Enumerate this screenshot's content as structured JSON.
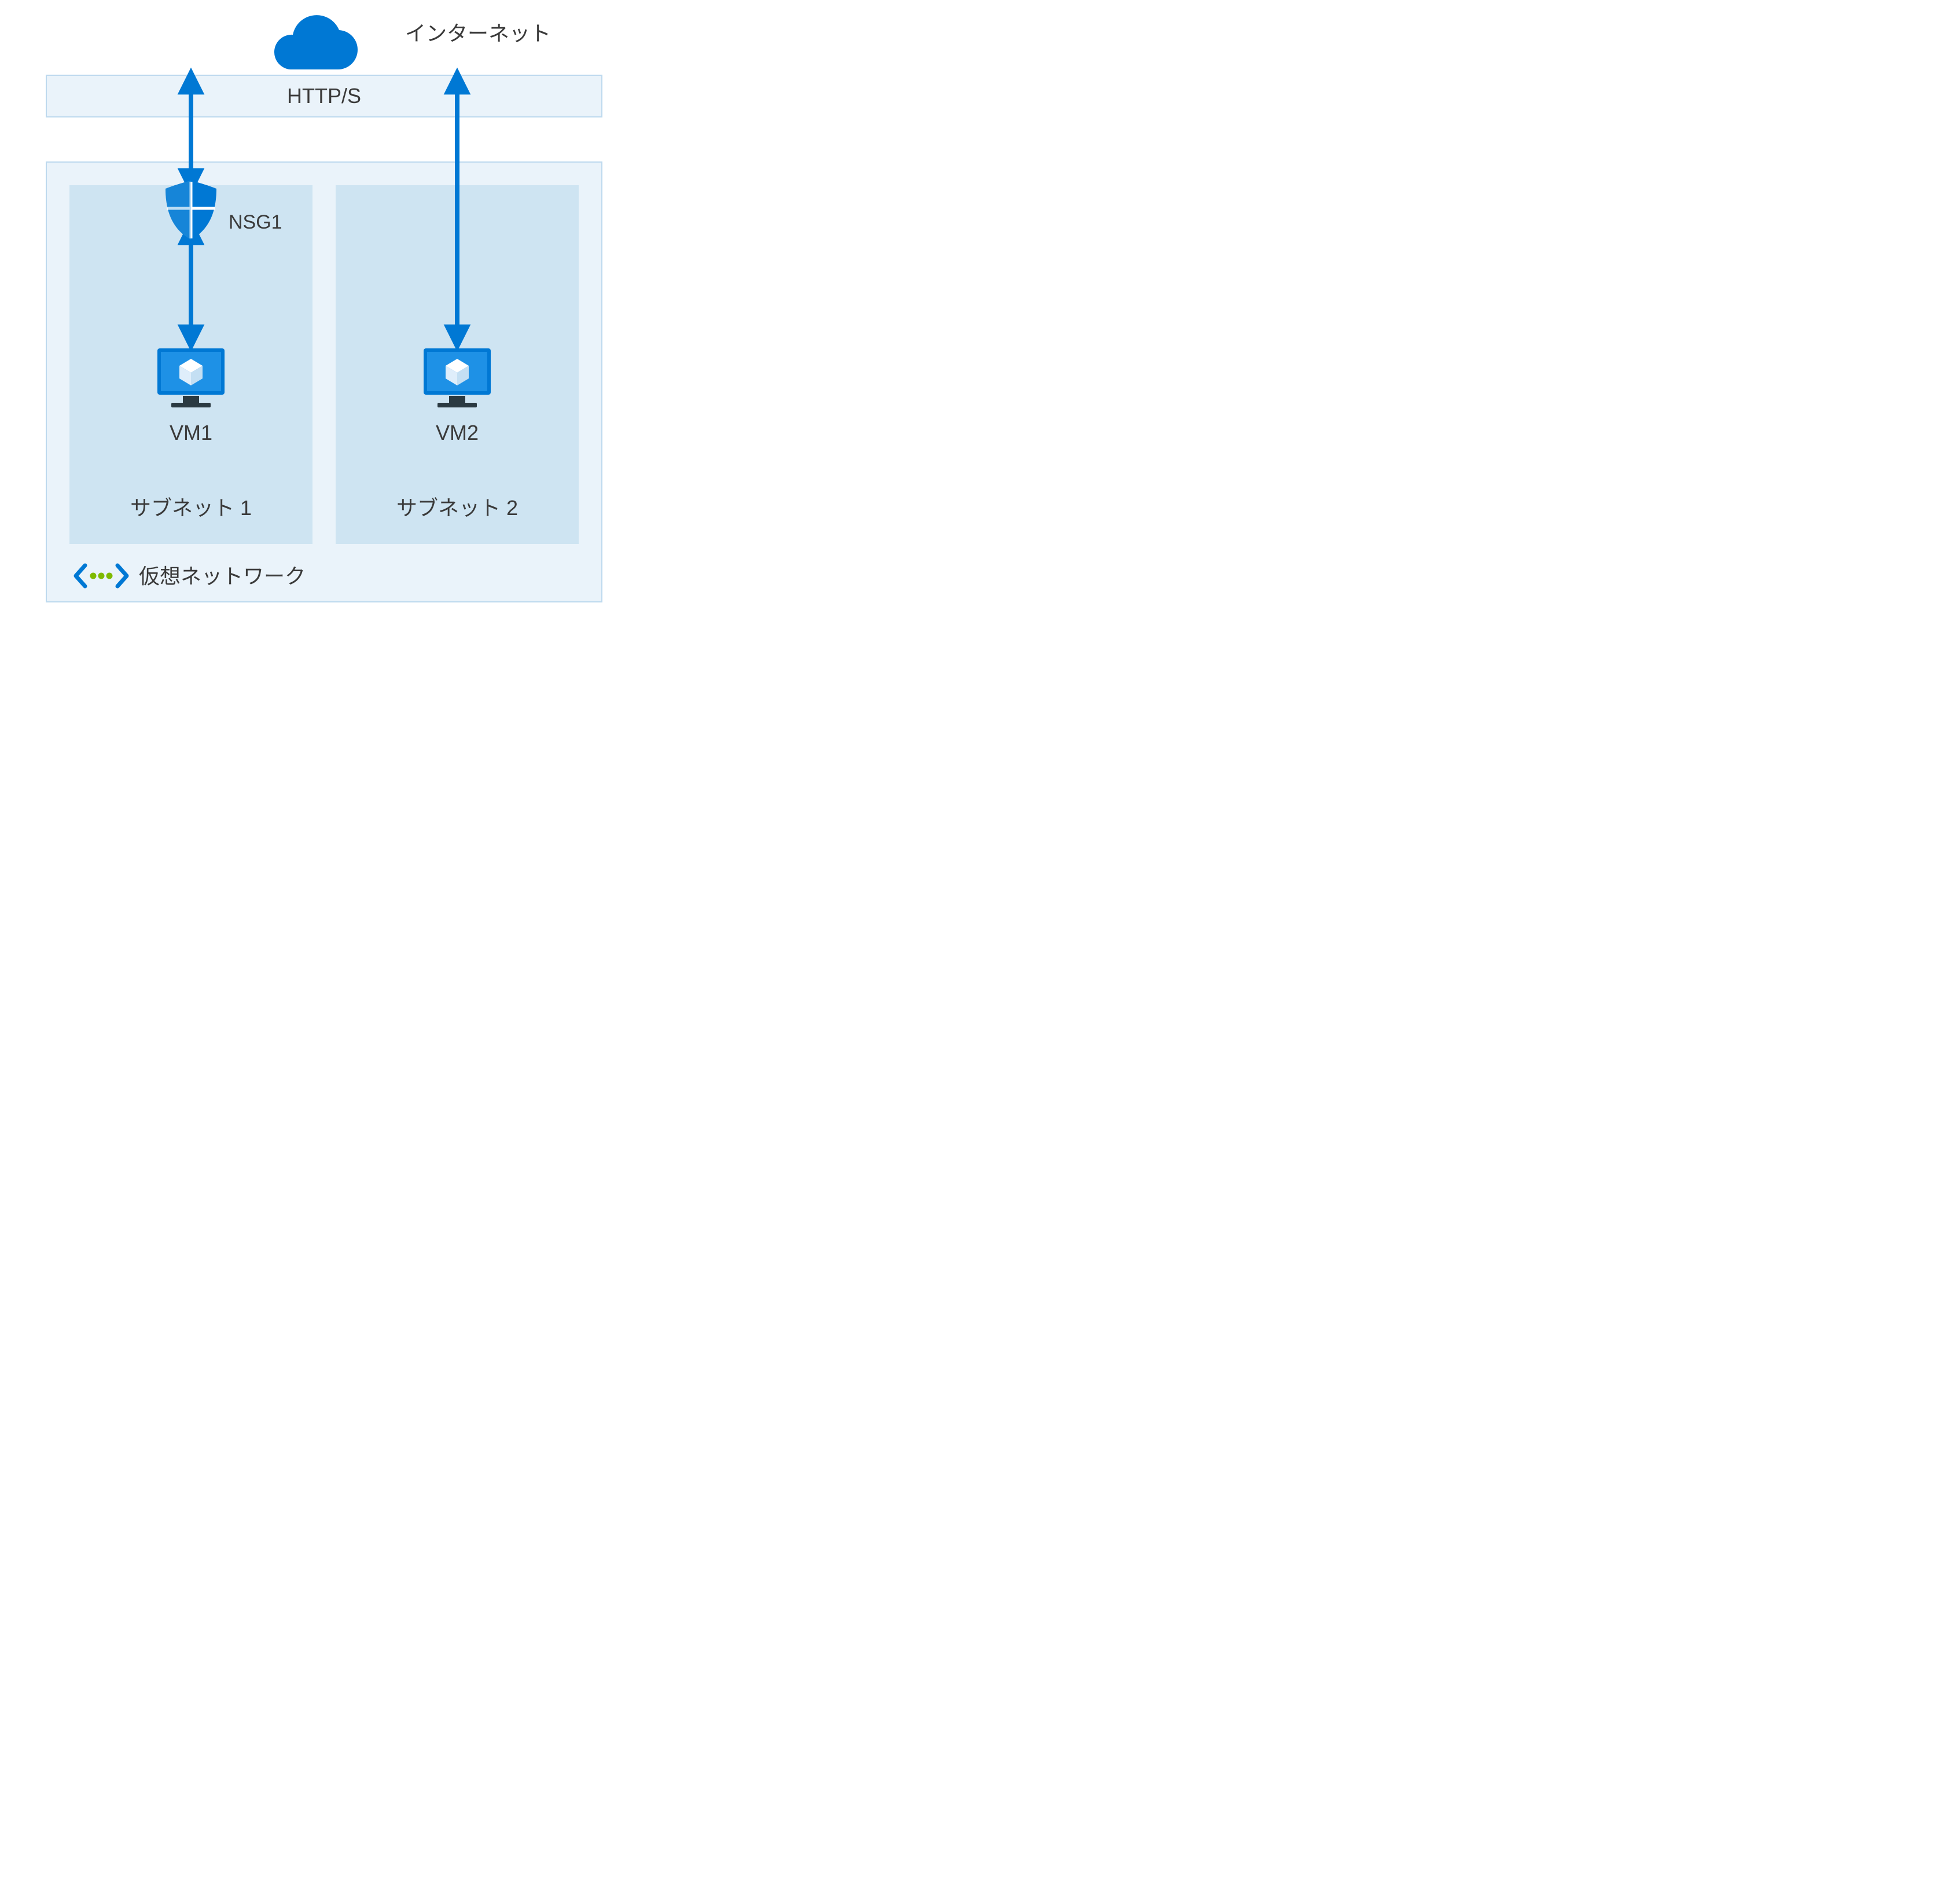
{
  "labels": {
    "internet": "インターネット",
    "protocol": "HTTP/S",
    "nsg": "NSG1",
    "vm1": "VM1",
    "vm2": "VM2",
    "subnet1": "サブネット 1",
    "subnet2": "サブネット 2",
    "vnet": "仮想ネットワーク"
  },
  "colors": {
    "azure": "#0078d4",
    "azureDark": "#005ba1",
    "panelLight": "#eaf3fa",
    "panelMid": "#cee4f2",
    "panelBorder": "#bdd9ee",
    "vnetStroke": "#0078d4",
    "vnetDots": "#7fba00",
    "text": "#3a3a3a"
  },
  "diagram": {
    "type": "network",
    "components": [
      {
        "id": "internet",
        "kind": "cloud",
        "label": "インターネット"
      },
      {
        "id": "https-bar",
        "kind": "channel",
        "label": "HTTP/S"
      },
      {
        "id": "vnet",
        "kind": "virtual-network",
        "label": "仮想ネットワーク",
        "children": [
          {
            "id": "subnet1",
            "kind": "subnet",
            "label": "サブネット 1",
            "children": [
              {
                "id": "vm1",
                "kind": "vm",
                "label": "VM1",
                "nsg": "NSG1"
              }
            ]
          },
          {
            "id": "subnet2",
            "kind": "subnet",
            "label": "サブネット 2",
            "children": [
              {
                "id": "vm2",
                "kind": "vm",
                "label": "VM2"
              }
            ]
          }
        ]
      }
    ],
    "connections": [
      {
        "from": "internet",
        "to": "vm1",
        "via": "HTTP/S",
        "nsg": "NSG1",
        "bidirectional": true
      },
      {
        "from": "internet",
        "to": "vm2",
        "via": "HTTP/S",
        "bidirectional": true
      }
    ]
  }
}
